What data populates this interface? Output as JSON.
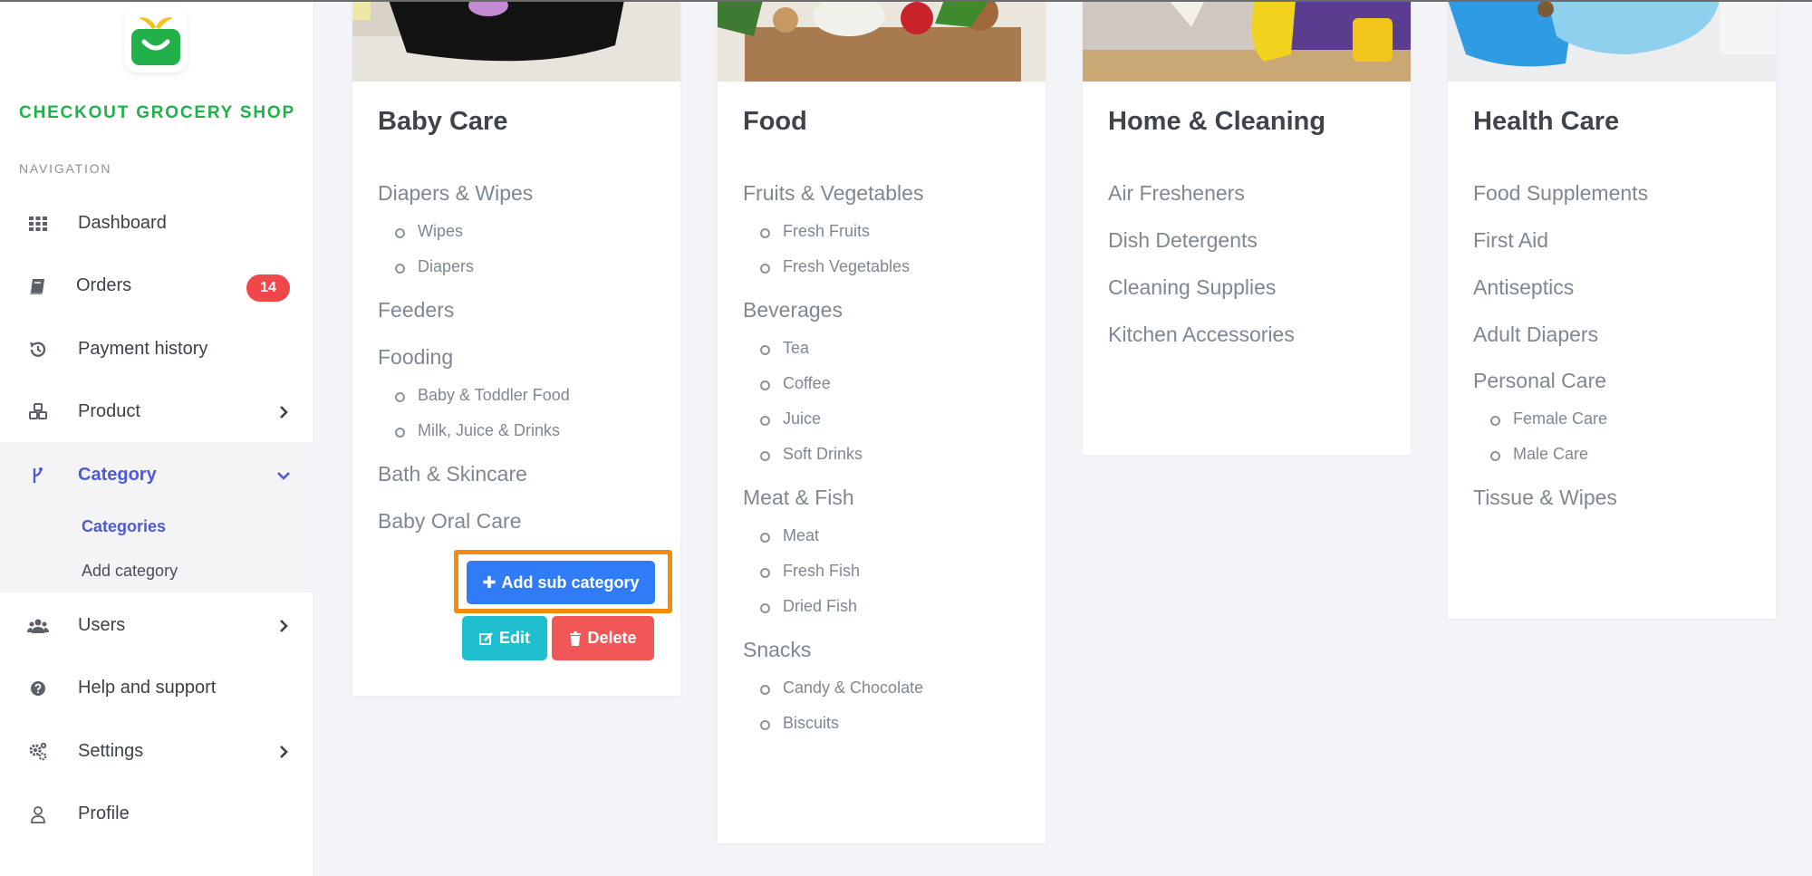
{
  "brand": {
    "name": "CHECKOUT GROCERY SHOP",
    "color": "#22b04b"
  },
  "sidebar": {
    "heading": "NAVIGATION",
    "items": [
      {
        "label": "Dashboard",
        "icon": "grid-icon"
      },
      {
        "label": "Orders",
        "icon": "book-icon",
        "badge": "14"
      },
      {
        "label": "Payment history",
        "icon": "history-icon"
      },
      {
        "label": "Product",
        "icon": "boxes-icon"
      },
      {
        "label": "Category",
        "icon": "branch-icon",
        "active": true
      },
      {
        "label": "Users",
        "icon": "users-icon"
      },
      {
        "label": "Help and support",
        "icon": "help-icon"
      },
      {
        "label": "Settings",
        "icon": "gears-icon"
      },
      {
        "label": "Profile",
        "icon": "user-icon"
      }
    ],
    "category_sub": [
      "Categories",
      "Add category"
    ]
  },
  "cards": [
    {
      "title": "Baby Care",
      "subs": [
        {
          "name": "Diapers & Wipes",
          "children": [
            "Wipes",
            "Diapers"
          ]
        },
        {
          "name": "Feeders",
          "children": []
        },
        {
          "name": "Fooding",
          "children": [
            "Baby & Toddler Food",
            "Milk, Juice & Drinks"
          ]
        },
        {
          "name": "Bath & Skincare",
          "children": []
        },
        {
          "name": "Baby Oral Care",
          "children": []
        }
      ]
    },
    {
      "title": "Food",
      "subs": [
        {
          "name": "Fruits & Vegetables",
          "children": [
            "Fresh Fruits",
            "Fresh Vegetables"
          ]
        },
        {
          "name": "Beverages",
          "children": [
            "Tea",
            "Coffee",
            "Juice",
            "Soft Drinks"
          ]
        },
        {
          "name": "Meat & Fish",
          "children": [
            "Meat",
            "Fresh Fish",
            "Dried Fish"
          ]
        },
        {
          "name": "Snacks",
          "children": [
            "Candy & Chocolate",
            "Biscuits"
          ]
        }
      ]
    },
    {
      "title": "Home & Cleaning",
      "subs": [
        {
          "name": "Air Fresheners",
          "children": []
        },
        {
          "name": "Dish Detergents",
          "children": []
        },
        {
          "name": "Cleaning Supplies",
          "children": []
        },
        {
          "name": "Kitchen Accessories",
          "children": []
        }
      ]
    },
    {
      "title": "Health Care",
      "subs": [
        {
          "name": "Food Supplements",
          "children": []
        },
        {
          "name": "First Aid",
          "children": []
        },
        {
          "name": "Antiseptics",
          "children": []
        },
        {
          "name": "Adult Diapers",
          "children": []
        },
        {
          "name": "Personal Care",
          "children": [
            "Female Care",
            "Male Care"
          ]
        },
        {
          "name": "Tissue & Wipes",
          "children": []
        }
      ]
    }
  ],
  "actions": {
    "add_sub": "Add sub category",
    "edit": "Edit",
    "delete": "Delete"
  },
  "colors": {
    "accent": "#4d59d8",
    "badge": "#f0474b",
    "add_button": "#2f7cf6",
    "edit_button": "#1fbfcf",
    "delete_button": "#f25757",
    "highlight": "#f58a0d"
  }
}
